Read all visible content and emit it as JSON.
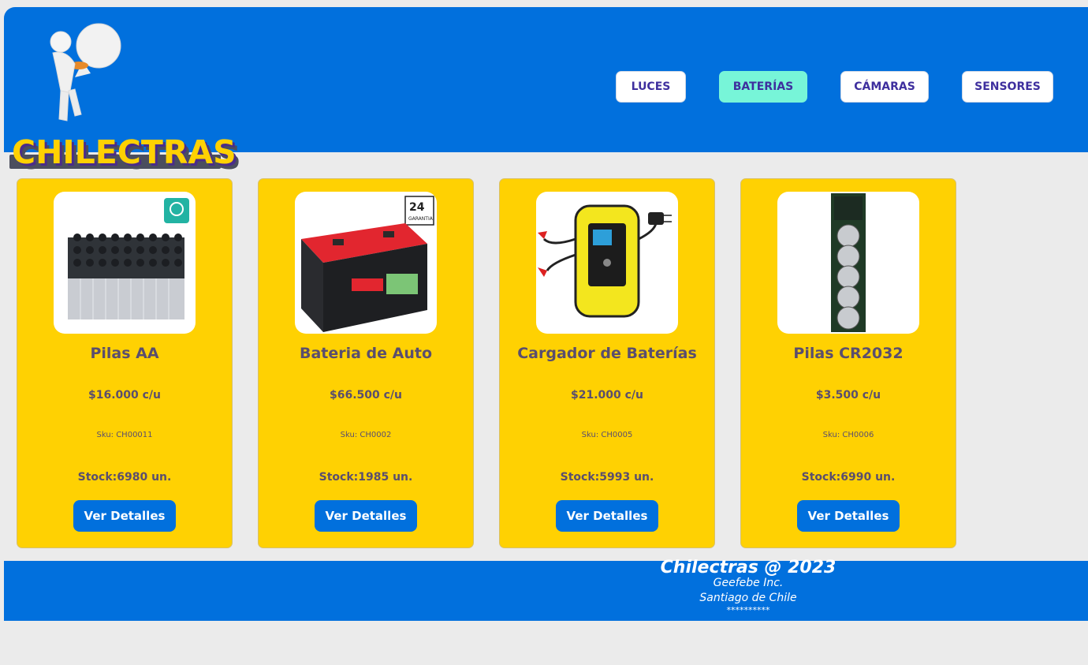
{
  "brand": {
    "name": "CHILECTRAS"
  },
  "nav": [
    {
      "label": "LUCES"
    },
    {
      "label": "BATERÍAS",
      "active": true
    },
    {
      "label": "CÁMARAS"
    },
    {
      "label": "SENSORES"
    }
  ],
  "products": [
    {
      "name": "Pilas AA",
      "price": "$16.000 c/u",
      "sku": "Sku: CH00011",
      "stock": "Stock:6980 un.",
      "button": "Ver Detalles"
    },
    {
      "name": "Bateria de Auto",
      "price": "$66.500 c/u",
      "sku": "Sku: CH0002",
      "stock": "Stock:1985 un.",
      "button": "Ver Detalles"
    },
    {
      "name": "Cargador de Baterías",
      "price": "$21.000 c/u",
      "sku": "Sku: CH0005",
      "stock": "Stock:5993 un.",
      "button": "Ver Detalles"
    },
    {
      "name": "Pilas CR2032",
      "price": "$3.500 c/u",
      "sku": "Sku: CH0006",
      "stock": "Stock:6990 un.",
      "button": "Ver Detalles"
    }
  ],
  "footer": {
    "title": "Chilectras @ 2023",
    "company": "Geefebe Inc.",
    "city": "Santiago de Chile",
    "stars": "**********"
  },
  "colors": {
    "primary": "#0170dd",
    "card": "#ffd102",
    "active_nav": "#77f5d8",
    "brand_text": "#ffd102"
  }
}
